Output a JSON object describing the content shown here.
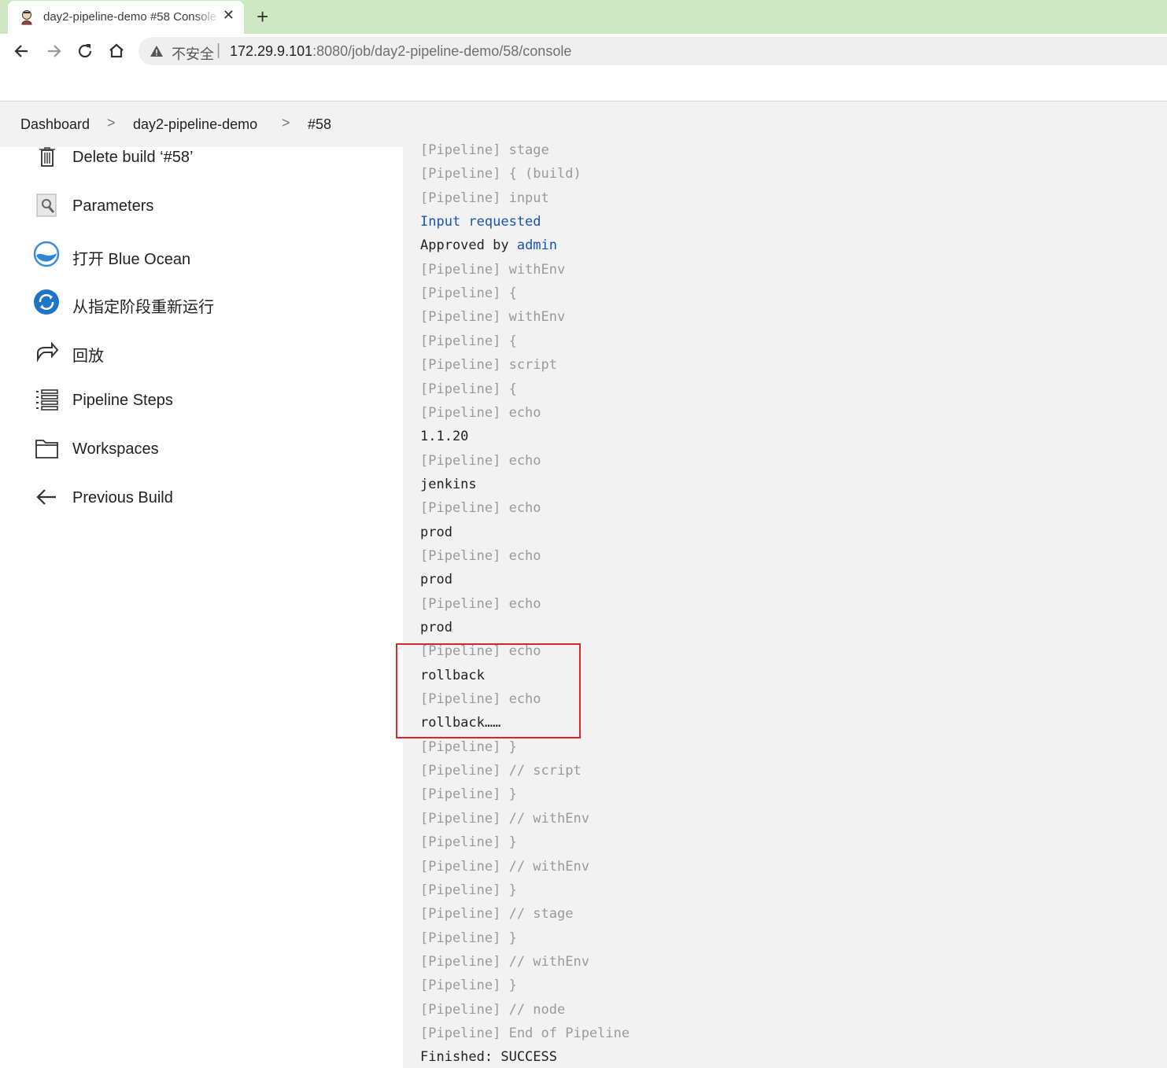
{
  "browser": {
    "tab_title": "day2-pipeline-demo #58 Console",
    "close_glyph": "✕",
    "newtab_glyph": "+",
    "security_text": "不安全",
    "separator": "|",
    "url_host": "172.29.9.101",
    "url_rest": ":8080/job/day2-pipeline-demo/58/console",
    "icons": [
      "jenkins-favicon",
      "back-icon",
      "forward-icon",
      "reload-icon",
      "home-icon",
      "warning-icon"
    ]
  },
  "breadcrumb": {
    "items": [
      "Dashboard",
      "day2-pipeline-demo",
      "#58"
    ],
    "separator": ">"
  },
  "sidebar": {
    "items": [
      {
        "label": "Delete build ‘#58’",
        "icon": "trash-icon"
      },
      {
        "label": "Parameters",
        "icon": "parameters-icon"
      },
      {
        "label": "打开 Blue Ocean",
        "icon": "blue-ocean-icon"
      },
      {
        "label": "从指定阶段重新运行",
        "icon": "restart-stage-icon"
      },
      {
        "label": "回放",
        "icon": "replay-icon"
      },
      {
        "label": "Pipeline Steps",
        "icon": "pipeline-steps-icon"
      },
      {
        "label": "Workspaces",
        "icon": "folder-icon"
      },
      {
        "label": "Previous Build",
        "icon": "arrow-left-icon"
      }
    ]
  },
  "console": {
    "lines": [
      {
        "text": "[Pipeline] stage",
        "kind": "pipeline"
      },
      {
        "text": "[Pipeline] { (build)",
        "kind": "pipeline"
      },
      {
        "text": "[Pipeline] input",
        "kind": "pipeline"
      },
      {
        "text": "Input requested",
        "kind": "link"
      },
      {
        "text": "Approved by ",
        "kind": "output",
        "link": "admin"
      },
      {
        "text": "[Pipeline] withEnv",
        "kind": "pipeline"
      },
      {
        "text": "[Pipeline] {",
        "kind": "pipeline"
      },
      {
        "text": "[Pipeline] withEnv",
        "kind": "pipeline"
      },
      {
        "text": "[Pipeline] {",
        "kind": "pipeline"
      },
      {
        "text": "[Pipeline] script",
        "kind": "pipeline"
      },
      {
        "text": "[Pipeline] {",
        "kind": "pipeline"
      },
      {
        "text": "[Pipeline] echo",
        "kind": "pipeline"
      },
      {
        "text": "1.1.20",
        "kind": "output"
      },
      {
        "text": "[Pipeline] echo",
        "kind": "pipeline"
      },
      {
        "text": "jenkins",
        "kind": "output"
      },
      {
        "text": "[Pipeline] echo",
        "kind": "pipeline"
      },
      {
        "text": "prod",
        "kind": "output"
      },
      {
        "text": "[Pipeline] echo",
        "kind": "pipeline"
      },
      {
        "text": "prod",
        "kind": "output"
      },
      {
        "text": "[Pipeline] echo",
        "kind": "pipeline"
      },
      {
        "text": "prod",
        "kind": "output"
      },
      {
        "text": "[Pipeline] echo",
        "kind": "pipeline"
      },
      {
        "text": "rollback",
        "kind": "output"
      },
      {
        "text": "[Pipeline] echo",
        "kind": "pipeline"
      },
      {
        "text": "rollback……",
        "kind": "output"
      },
      {
        "text": "[Pipeline] }",
        "kind": "pipeline"
      },
      {
        "text": "[Pipeline] // script",
        "kind": "pipeline"
      },
      {
        "text": "[Pipeline] }",
        "kind": "pipeline"
      },
      {
        "text": "[Pipeline] // withEnv",
        "kind": "pipeline"
      },
      {
        "text": "[Pipeline] }",
        "kind": "pipeline"
      },
      {
        "text": "[Pipeline] // withEnv",
        "kind": "pipeline"
      },
      {
        "text": "[Pipeline] }",
        "kind": "pipeline"
      },
      {
        "text": "[Pipeline] // stage",
        "kind": "pipeline"
      },
      {
        "text": "[Pipeline] }",
        "kind": "pipeline"
      },
      {
        "text": "[Pipeline] // withEnv",
        "kind": "pipeline"
      },
      {
        "text": "[Pipeline] }",
        "kind": "pipeline"
      },
      {
        "text": "[Pipeline] // node",
        "kind": "pipeline"
      },
      {
        "text": "[Pipeline] End of Pipeline",
        "kind": "pipeline"
      },
      {
        "text": "Finished: SUCCESS",
        "kind": "output"
      }
    ]
  },
  "colors": {
    "tabstrip": "#cfe8c4",
    "console_bg": "#f2f2f2",
    "pipeline_text": "#9a9a9a",
    "link": "#1a53b0",
    "highlight_box": "#d9262c"
  }
}
